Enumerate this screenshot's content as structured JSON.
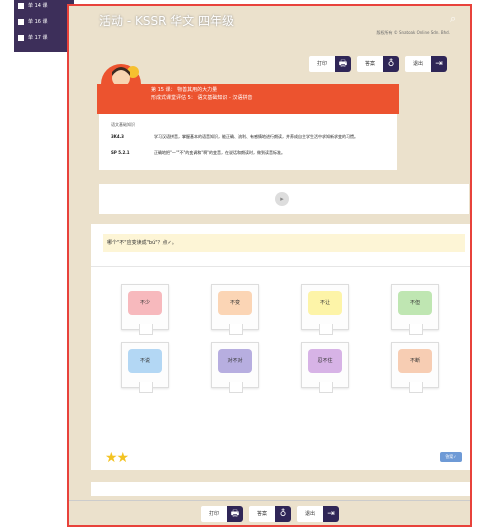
{
  "background_list": {
    "rows": [
      "单 14 课",
      "单 16 课",
      "单 17 课"
    ]
  },
  "header": {
    "title": "活动 - KSSR 华文 四年级",
    "copyright": "版权所有 © Snatoak Online Sdn. Bhd.",
    "search_icon": "search-icon"
  },
  "toolbar": {
    "print": "打印",
    "answer": "答案",
    "exit": "退出"
  },
  "lesson": {
    "line1": "第 15 课：  物善其用的大力量",
    "line2": "形成式课堂评估 5：  语文基础知识 - 汉语拼音"
  },
  "content": {
    "heading": "语文基础知识",
    "items": [
      {
        "code": "3K4.3",
        "text": "学习汉语拼音，掌握基本的语音知识，能正确、流利、有感情地进行朗读，并养成自主学生活中求知新求变的习惯。"
      },
      {
        "code": "SP 5.2.1",
        "text": "正确地把\"一\"\"不\"的变调和\"啊\"的变音，在说话和朗读时，做到读音标准。"
      }
    ]
  },
  "question": {
    "text": "哪个\"不\"应变读成\"bú\"？点✓。"
  },
  "options": [
    {
      "label": "不少",
      "color": "#f7b9bd"
    },
    {
      "label": "不变",
      "color": "#fbd5b5"
    },
    {
      "label": "不让",
      "color": "#fdf4a8"
    },
    {
      "label": "不但",
      "color": "#bfe6b2"
    },
    {
      "label": "不说",
      "color": "#b3d7f4"
    },
    {
      "label": "对不对",
      "color": "#b7aee0"
    },
    {
      "label": "忍不住",
      "color": "#d7b3e6"
    },
    {
      "label": "不断",
      "color": "#f7cdb3"
    }
  ],
  "stars": "★★",
  "submit": "答案✓"
}
